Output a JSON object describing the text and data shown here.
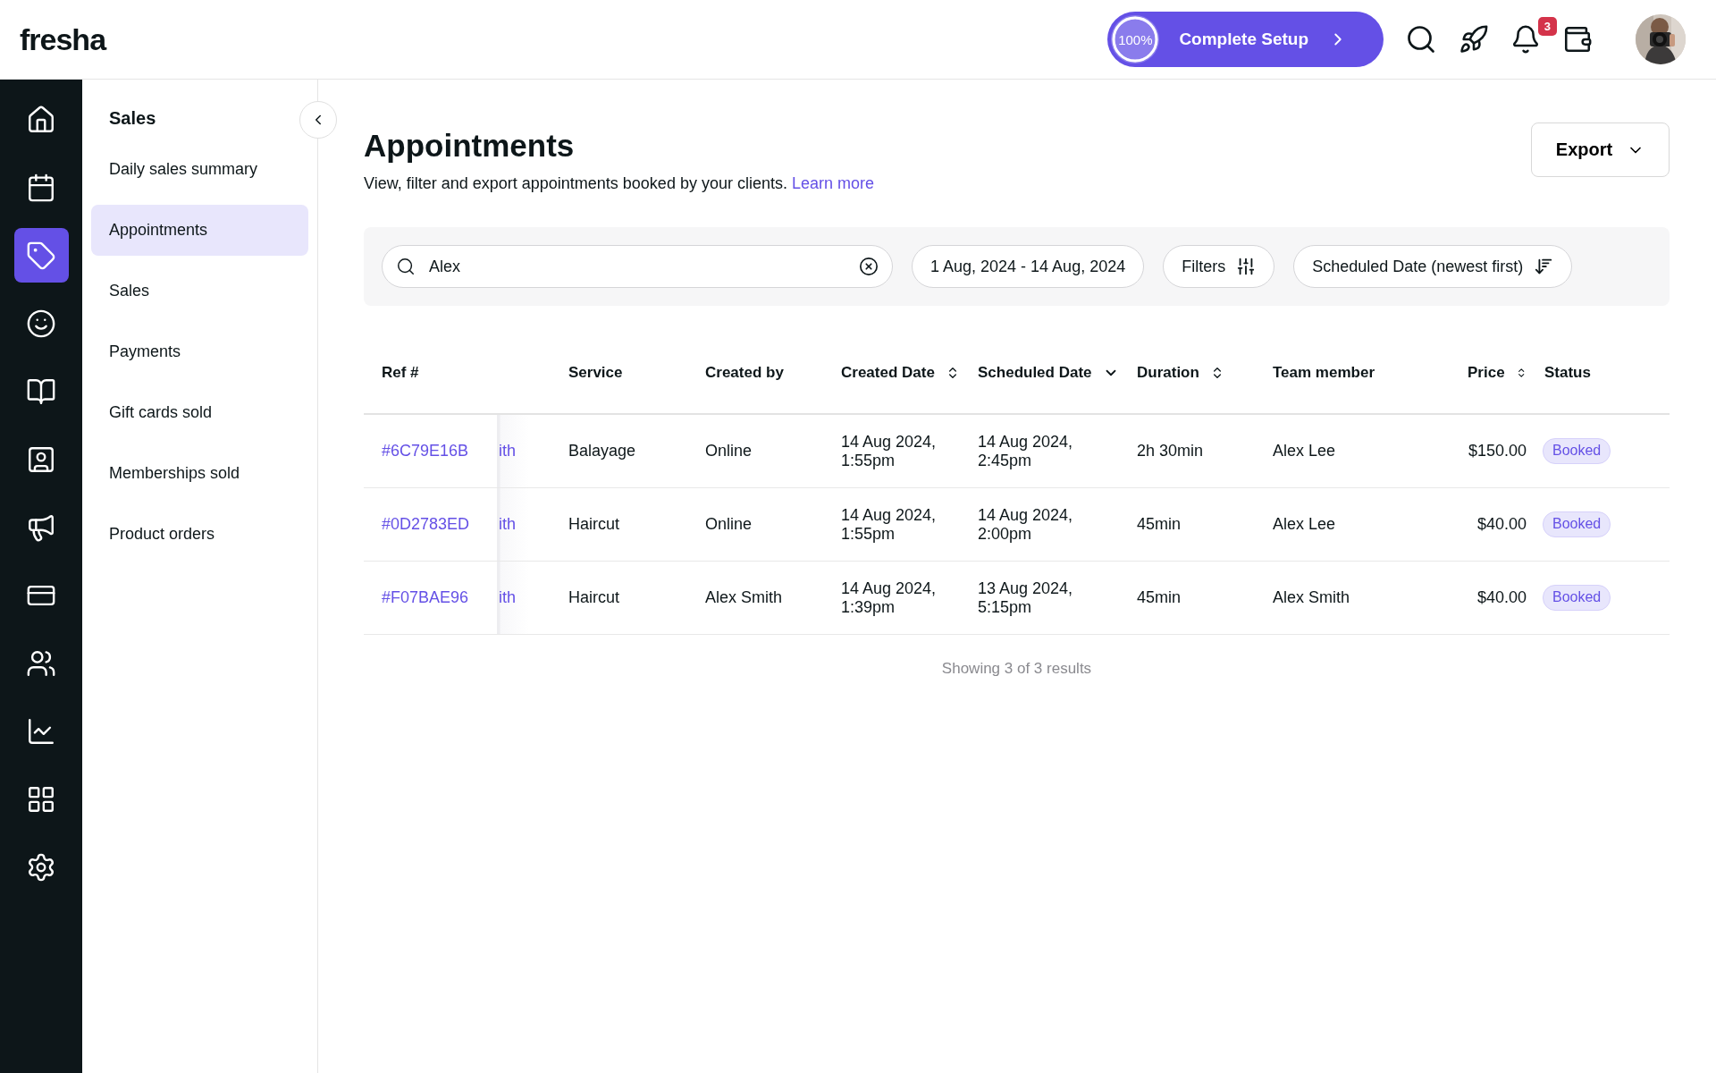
{
  "topbar": {
    "logo": "fresha",
    "setup": {
      "percent": "100%",
      "level": 1,
      "label": "Complete Setup"
    },
    "notifications": {
      "count": "3"
    }
  },
  "rail": [
    {
      "selected": false
    },
    {
      "selected": false
    },
    {
      "selected": true
    },
    {
      "selected": false
    },
    {
      "selected": false
    },
    {
      "selected": false
    },
    {
      "selected": false
    },
    {
      "selected": false
    },
    {
      "selected": false
    },
    {
      "selected": false
    },
    {
      "selected": false
    },
    {
      "selected": false
    }
  ],
  "sidebar": {
    "title": "Sales",
    "items": [
      {
        "label": "Daily sales summary",
        "selected": false
      },
      {
        "label": "Appointments",
        "selected": true
      },
      {
        "label": "Sales",
        "selected": false
      },
      {
        "label": "Payments",
        "selected": false
      },
      {
        "label": "Gift cards sold",
        "selected": false
      },
      {
        "label": "Memberships sold",
        "selected": false
      },
      {
        "label": "Product orders",
        "selected": false
      }
    ]
  },
  "page": {
    "title": "Appointments",
    "description": "View, filter and export appointments booked by your clients.",
    "link": "Learn more",
    "export": "Export"
  },
  "toolbar": {
    "search": "Alex",
    "date_range": "1 Aug, 2024 - 14 Aug, 2024",
    "filters": "Filters",
    "sort": "Scheduled Date (newest first)"
  },
  "table": {
    "columns": [
      {
        "label": "Ref #",
        "sortable": false,
        "sorted": false
      },
      {
        "label": "Service",
        "sortable": false,
        "sorted": false
      },
      {
        "label": "Created by",
        "sortable": false,
        "sorted": false
      },
      {
        "label": "Created Date",
        "sortable": true,
        "sorted": false
      },
      {
        "label": "Scheduled Date",
        "sortable": true,
        "sorted": true
      },
      {
        "label": "Duration",
        "sortable": true,
        "sorted": false
      },
      {
        "label": "Team member",
        "sortable": false,
        "sorted": false
      },
      {
        "label": "Price",
        "sortable": true,
        "sorted": false
      },
      {
        "label": "Status",
        "sortable": false,
        "sorted": false
      }
    ],
    "rows": [
      {
        "ref": "#6C79E16B",
        "column_2": "ith",
        "service": "Balayage",
        "created_by": "Online",
        "created_date": "14 Aug 2024,\n1:55pm",
        "scheduled_date": "14 Aug 2024,\n2:45pm",
        "duration": "2h 30min",
        "team_member": "Alex Lee",
        "price": "$150.00",
        "status": "Booked"
      },
      {
        "ref": "#0D2783ED",
        "column_2": "ith",
        "service": "Haircut",
        "created_by": "Online",
        "created_date": "14 Aug 2024,\n1:55pm",
        "scheduled_date": "14 Aug 2024,\n2:00pm",
        "duration": "45min",
        "team_member": "Alex Lee",
        "price": "$40.00",
        "status": "Booked"
      },
      {
        "ref": "#F07BAE96",
        "column_2": "ith",
        "service": "Haircut",
        "created_by": "Alex Smith",
        "created_date": "14 Aug 2024,\n1:39pm",
        "scheduled_date": "13 Aug 2024,\n5:15pm",
        "duration": "45min",
        "team_member": "Alex Smith",
        "price": "$40.00",
        "status": "Booked"
      }
    ],
    "footer": "Showing 3 of 3 results"
  }
}
